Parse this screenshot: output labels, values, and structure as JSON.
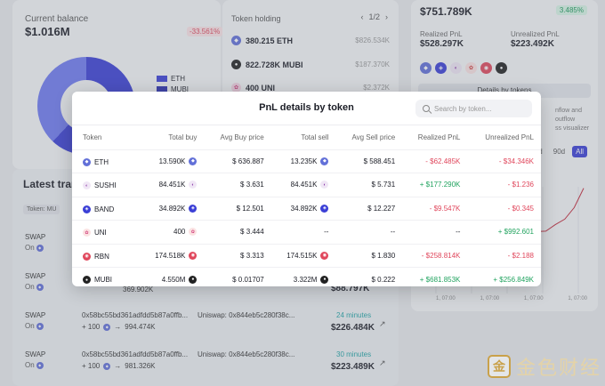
{
  "colors": {
    "accent": "#3b3fd6",
    "positive": "#21a35f",
    "negative": "#e0475c",
    "teal": "#22a4a6"
  },
  "balance": {
    "label": "Current balance",
    "value": "$1.016M",
    "change": "-33.561%",
    "legend": [
      "ETH",
      "MUBI"
    ]
  },
  "holding": {
    "title": "Token holding",
    "page": "1/2",
    "rows": [
      {
        "amount": "380.215 ETH",
        "usd": "$826.534K",
        "icon": "eth-icon"
      },
      {
        "amount": "822.728K MUBI",
        "usd": "$187.370K",
        "icon": "mubi-icon"
      },
      {
        "amount": "400 UNI",
        "usd": "$2.372K",
        "icon": "uni-icon"
      }
    ]
  },
  "pnl_card": {
    "value": "$751.789K",
    "badge": "3.485%",
    "realized_label": "Realized PnL",
    "realized_value": "$528.297K",
    "unrealized_label": "Unrealized PnL",
    "unrealized_value": "$223.492K",
    "details_button": "Details by tokens",
    "note_line1": "nflow and outflow",
    "note_line2": "ss visualizer",
    "ranges": [
      "d",
      "90d",
      "All"
    ],
    "active_range": "All",
    "ticks": [
      "1, 07:00",
      "1, 07:00",
      "1, 07:00",
      "1, 07:00"
    ],
    "chart_points": [
      0.03,
      0.03,
      0.03,
      0.03,
      0.05,
      0.04,
      0.04,
      0.04,
      0.03,
      0.03,
      0.03,
      0.03,
      0.04,
      0.18,
      0.3,
      0.55,
      0.97
    ]
  },
  "transactions": {
    "title": "Latest tran",
    "filter": "Token:  MU",
    "rows": [
      {
        "type": "SWAP",
        "on": "On",
        "hash": "",
        "dex": "",
        "amt_in": "",
        "amt_out": "",
        "time": "",
        "usd": ""
      },
      {
        "type": "SWAP",
        "on": "On",
        "hash": "",
        "dex": "",
        "amt_in": "",
        "amt_out": "369.902K",
        "time": "",
        "usd": "$88.797K"
      },
      {
        "type": "SWAP",
        "on": "On",
        "hash": "0x58bc55bd361adfdd5b87a0ffb...",
        "dex": "Uniswap: 0x844eb5c280f38c...",
        "amt_in": "+ 100",
        "amt_out": "994.474K",
        "time": "24 minutes",
        "usd": "$226.484K"
      },
      {
        "type": "SWAP",
        "on": "On",
        "hash": "0x58bc55bd361adfdd5b87a0ffb...",
        "dex": "Uniswap: 0x844eb5c280f38c...",
        "amt_in": "+ 100",
        "amt_out": "981.326K",
        "time": "30 minutes",
        "usd": "$223.489K"
      }
    ]
  },
  "modal": {
    "title": "PnL details by token",
    "search_placeholder": "Search by token...",
    "columns": [
      "Token",
      "Total buy",
      "Avg Buy price",
      "Total sell",
      "Avg Sell price",
      "Realized PnL",
      "Unrealized PnL"
    ],
    "rows": [
      {
        "token": "ETH",
        "icon": "eth-icon",
        "total_buy": "13.590K",
        "avg_buy": "$ 636.887",
        "total_sell": "13.235K",
        "avg_sell": "$ 588.451",
        "realized": "- $62.485K",
        "realized_sign": "neg",
        "unrealized": "- $34.346K",
        "unrealized_sign": "neg"
      },
      {
        "token": "SUSHI",
        "icon": "sushi-icon",
        "total_buy": "84.451K",
        "avg_buy": "$ 3.631",
        "total_sell": "84.451K",
        "avg_sell": "$ 5.731",
        "realized": "+ $177.290K",
        "realized_sign": "pos",
        "unrealized": "- $1.236",
        "unrealized_sign": "neg"
      },
      {
        "token": "BAND",
        "icon": "band-icon",
        "total_buy": "34.892K",
        "avg_buy": "$ 12.501",
        "total_sell": "34.892K",
        "avg_sell": "$ 12.227",
        "realized": "- $9.547K",
        "realized_sign": "neg",
        "unrealized": "- $0.345",
        "unrealized_sign": "neg"
      },
      {
        "token": "UNI",
        "icon": "uni-icon",
        "total_buy": "400",
        "avg_buy": "$ 3.444",
        "total_sell": "--",
        "avg_sell": "--",
        "realized": "--",
        "realized_sign": "none",
        "unrealized": "+ $992.601",
        "unrealized_sign": "pos"
      },
      {
        "token": "RBN",
        "icon": "rbn-icon",
        "total_buy": "174.518K",
        "avg_buy": "$ 3.313",
        "total_sell": "174.515K",
        "avg_sell": "$ 1.830",
        "realized": "- $258.814K",
        "realized_sign": "neg",
        "unrealized": "- $2.188",
        "unrealized_sign": "neg"
      },
      {
        "token": "MUBI",
        "icon": "mubi-icon",
        "total_buy": "4.550M",
        "avg_buy": "$ 0.01707",
        "total_sell": "3.322M",
        "avg_sell": "$ 0.222",
        "realized": "+ $681.853K",
        "realized_sign": "pos",
        "unrealized": "+ $256.849K",
        "unrealized_sign": "pos"
      }
    ]
  },
  "watermark": {
    "logo": "金",
    "text": "金色财经"
  }
}
